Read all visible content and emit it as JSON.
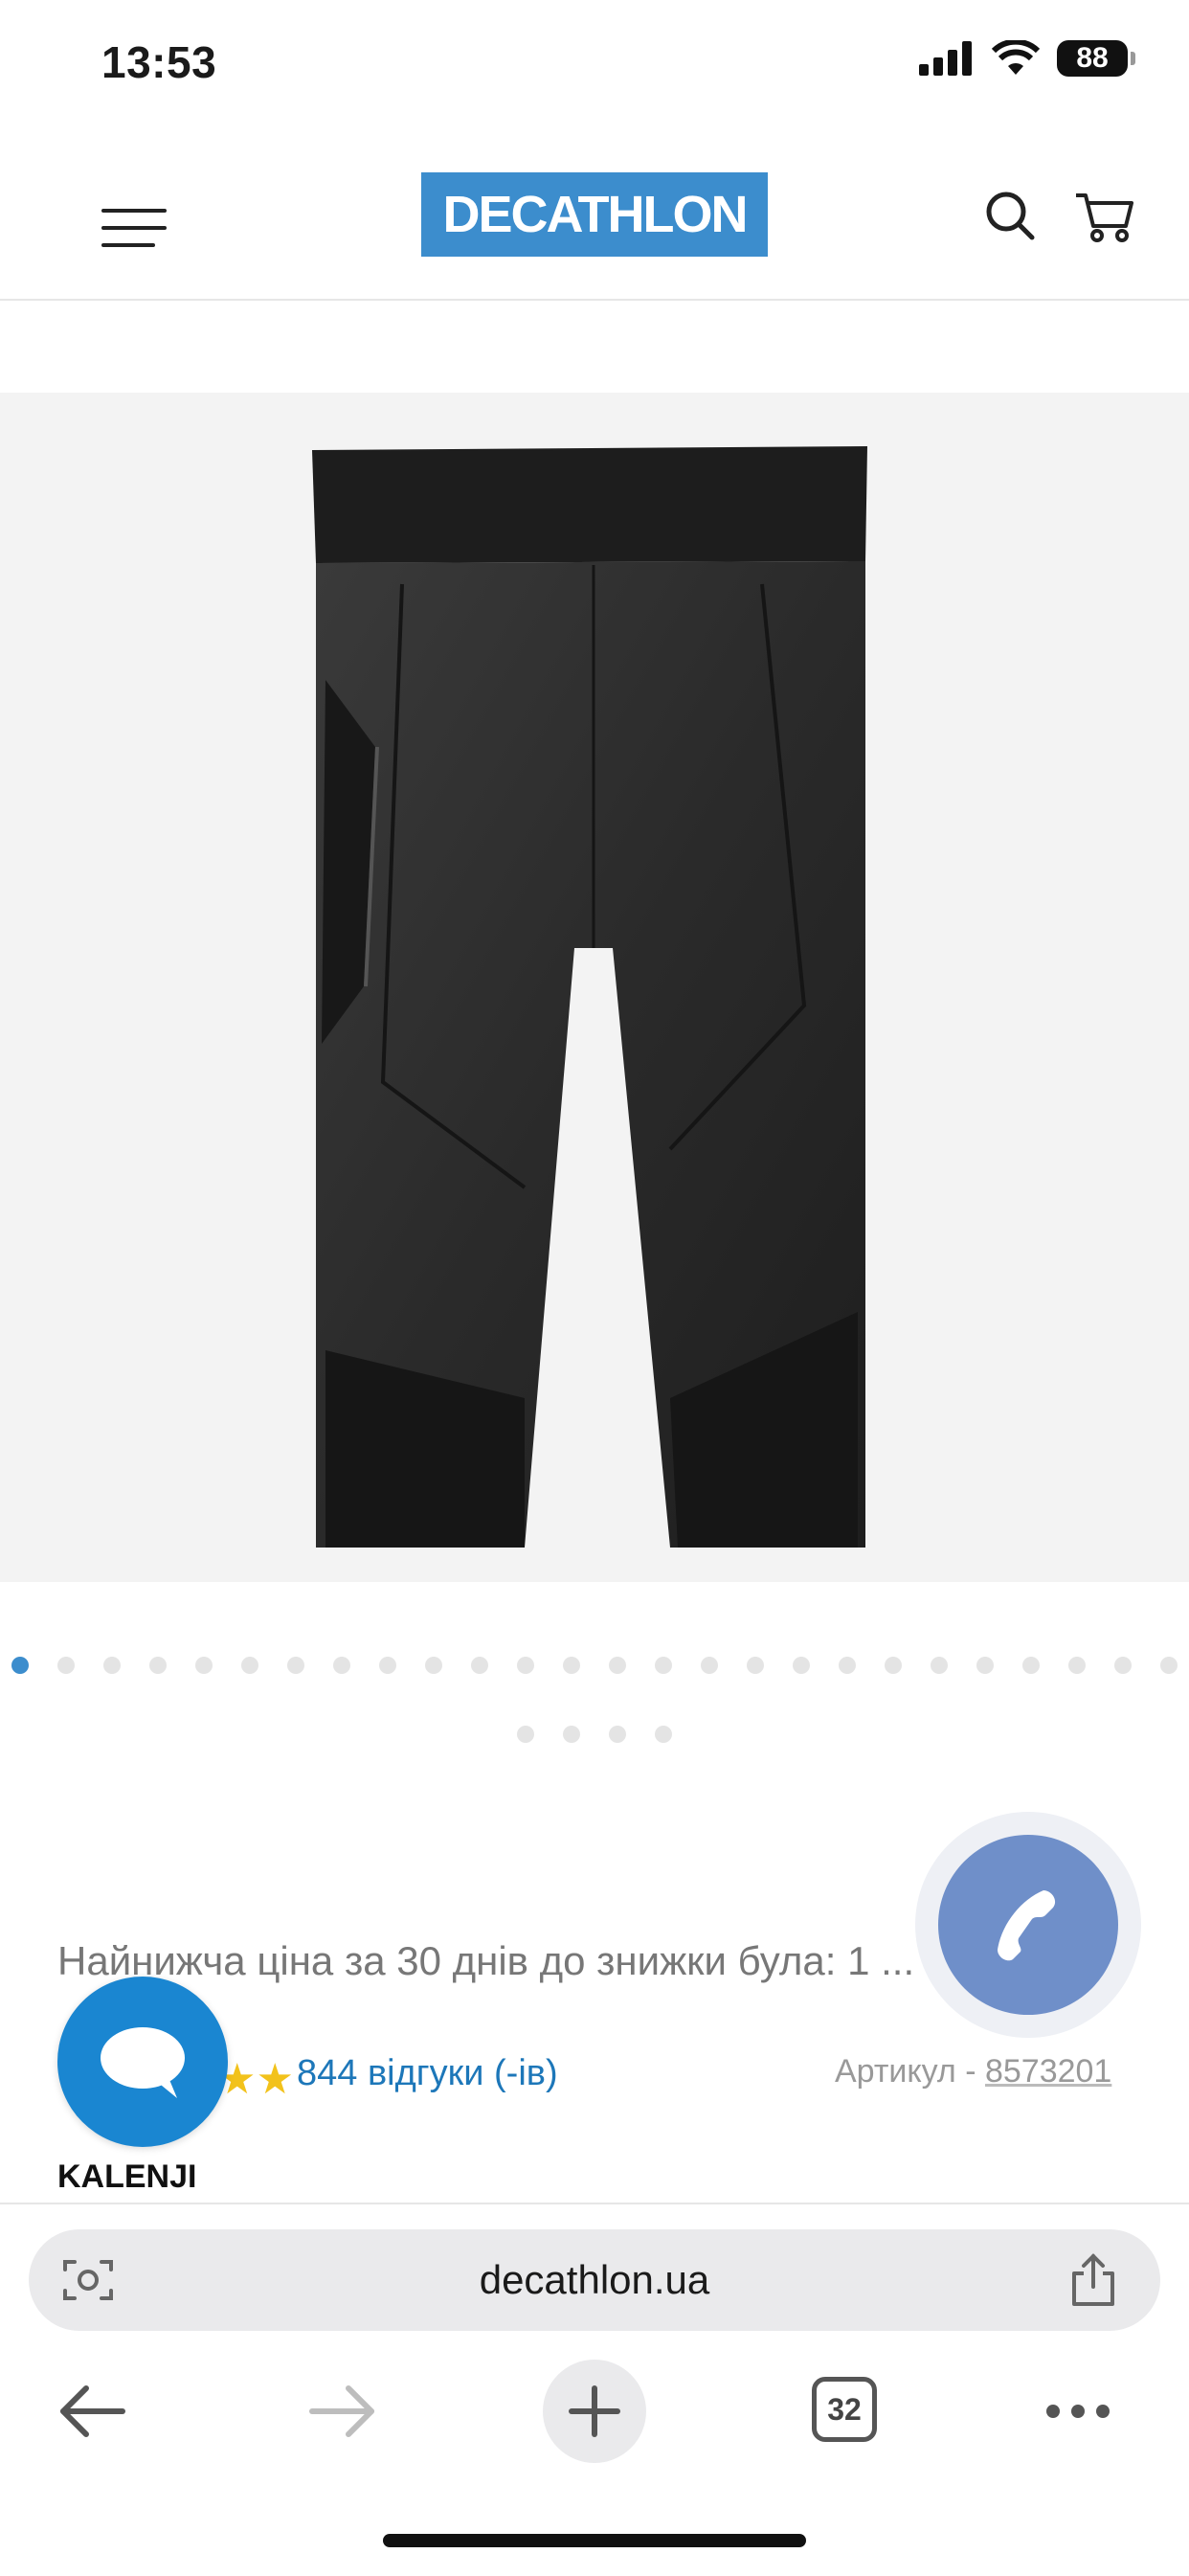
{
  "status_bar": {
    "time": "13:53",
    "battery": "88"
  },
  "header": {
    "logo_text": "DECATHLON"
  },
  "product": {
    "image_slides_total": 30,
    "active_slide": 1,
    "price_note": "Найнижча ціна за 30 днів до знижки була: 1 ...",
    "rating_stars": "★★",
    "reviews": "844 відгуки (-ів)",
    "article_label": "Артикул - ",
    "article_code": "8573201",
    "brand": "KALENJI"
  },
  "browser": {
    "url": "decathlon.ua",
    "tabs_count": "32"
  },
  "colors": {
    "accent": "#3c8dcd",
    "chat": "#1a86d1",
    "phone": "#6f8fc9",
    "link": "#1d77b9"
  }
}
